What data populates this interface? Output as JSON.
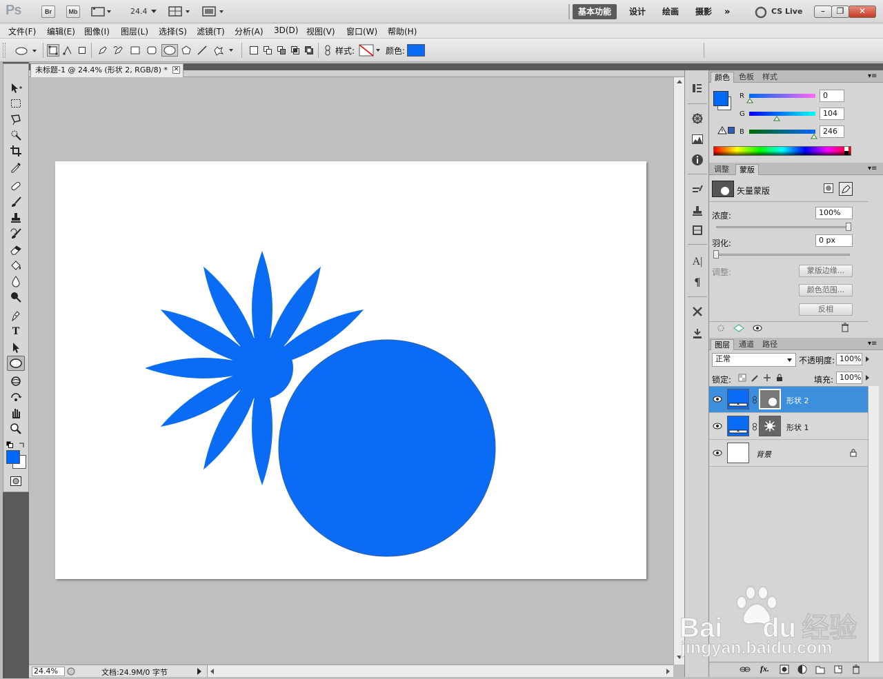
{
  "app": {
    "logo": "Ps",
    "bridge": "Br",
    "minibridge": "Mb",
    "zoom": "24.4",
    "cslive": "CS Live"
  },
  "workspaces": [
    "基本功能",
    "设计",
    "绘画",
    "摄影"
  ],
  "menu": [
    "文件(F)",
    "编辑(E)",
    "图像(I)",
    "图层(L)",
    "选择(S)",
    "滤镜(T)",
    "分析(A)",
    "3D(D)",
    "视图(V)",
    "窗口(W)",
    "帮助(H)"
  ],
  "options": {
    "style_label": "样式:",
    "color_label": "颜色:",
    "fill_color": "#0a6cf5"
  },
  "document": {
    "tab": "未标题-1 @ 24.4% (形状 2, RGB/8) *",
    "status_zoom": "24.4%",
    "status_doc": "文档:24.9M/0 字节",
    "shape_color": "#0a6cf5"
  },
  "color_panel": {
    "tabs": [
      "颜色",
      "色板",
      "样式"
    ],
    "r_label": "R",
    "g_label": "G",
    "b_label": "B",
    "r": "0",
    "g": "104",
    "b": "246",
    "foreground": "#0068f6"
  },
  "masks_panel": {
    "tabs": [
      "调整",
      "蒙版"
    ],
    "title": "矢量蒙版",
    "density_label": "浓度:",
    "density": "100%",
    "feather_label": "羽化:",
    "feather": "0 px",
    "refine_label": "调整:",
    "btn_edge": "蒙版边缘...",
    "btn_range": "颜色范围...",
    "btn_invert": "反相"
  },
  "layers_panel": {
    "tabs": [
      "图层",
      "通道",
      "路径"
    ],
    "blend": "正常",
    "opacity_label": "不透明度:",
    "opacity": "100%",
    "lock_label": "锁定:",
    "fill_label": "填充:",
    "fill": "100%",
    "layers": [
      {
        "name": "形状 2",
        "selected": true
      },
      {
        "name": "形状 1",
        "selected": false
      },
      {
        "name": "背景",
        "selected": false
      }
    ]
  },
  "watermark": {
    "brand": "Bai",
    "brand2": "du",
    "brand3": "经验",
    "url": "jingyan.baidu.com"
  }
}
